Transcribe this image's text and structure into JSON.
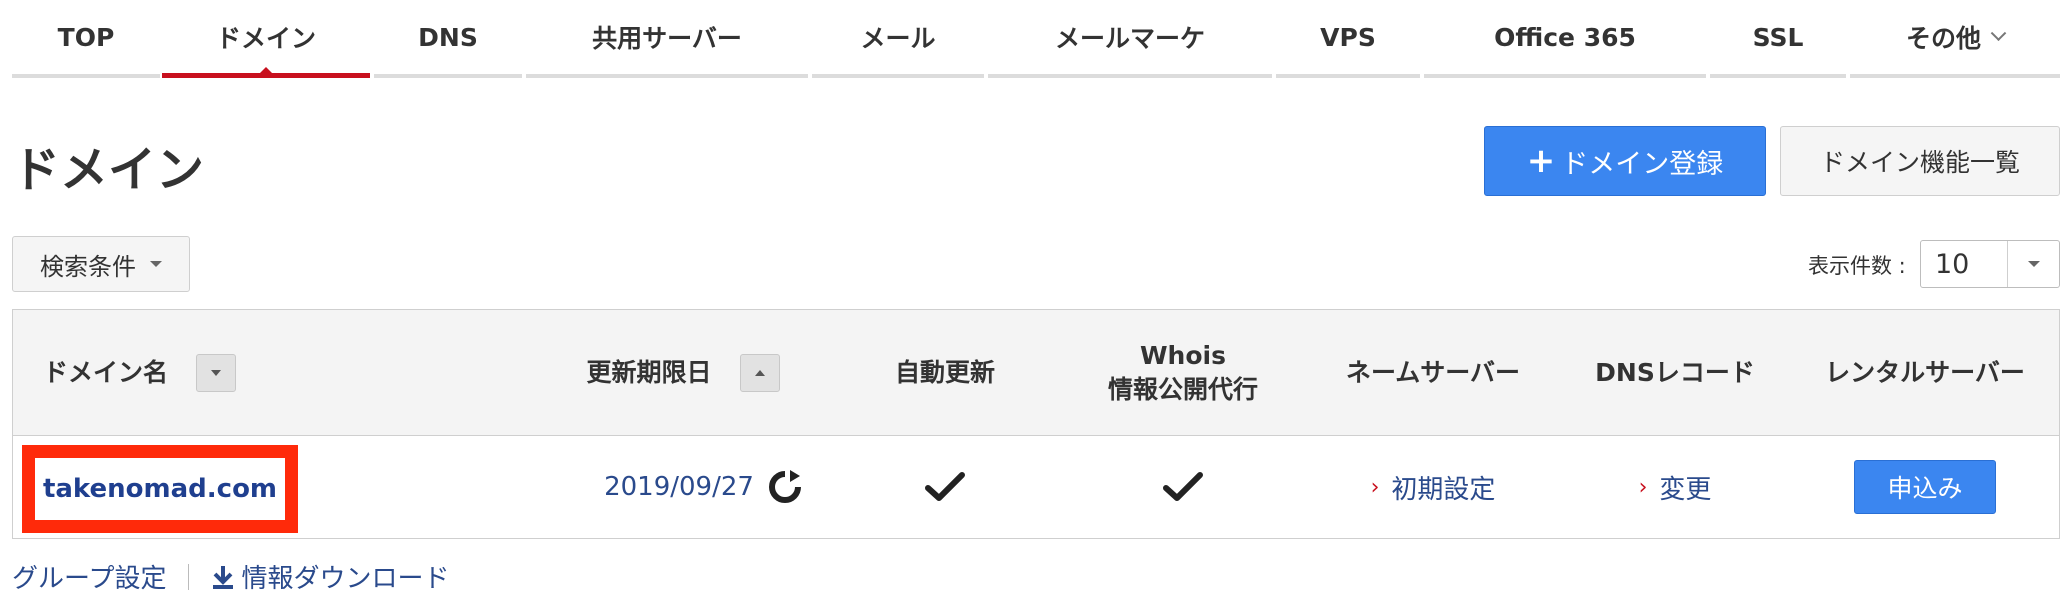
{
  "nav": {
    "items": [
      {
        "label": "TOP"
      },
      {
        "label": "ドメイン"
      },
      {
        "label": "DNS"
      },
      {
        "label": "共用サーバー"
      },
      {
        "label": "メール"
      },
      {
        "label": "メールマーケ"
      },
      {
        "label": "VPS"
      },
      {
        "label": "Office 365"
      },
      {
        "label": "SSL"
      },
      {
        "label": "その他"
      }
    ],
    "active_index": 1
  },
  "page": {
    "title": "ドメイン",
    "register_button": "ドメイン登録",
    "features_button": "ドメイン機能一覧"
  },
  "filters": {
    "search_label": "検索条件",
    "per_page_label": "表示件数 :",
    "per_page_value": "10"
  },
  "table": {
    "headers": {
      "domain": "ドメイン名",
      "expiry": "更新期限日",
      "auto_renew": "自動更新",
      "whois_line1": "Whois",
      "whois_line2": "情報公開代行",
      "nameserver": "ネームサーバー",
      "dns_record": "DNSレコード",
      "rental_server": "レンタルサーバー"
    },
    "rows": [
      {
        "domain": "takenomad.com",
        "expiry": "2019/09/27",
        "auto_renew": true,
        "whois": true,
        "nameserver_link": "初期設定",
        "dns_link": "変更",
        "rental_button": "申込み"
      }
    ]
  },
  "footer": {
    "group_settings": "グループ設定",
    "download": "情報ダウンロード"
  },
  "colors": {
    "accent_red": "#c8101e",
    "primary_blue": "#3b86f0",
    "highlight_red": "#ff2a0a",
    "link_blue": "#2a4a8c"
  }
}
